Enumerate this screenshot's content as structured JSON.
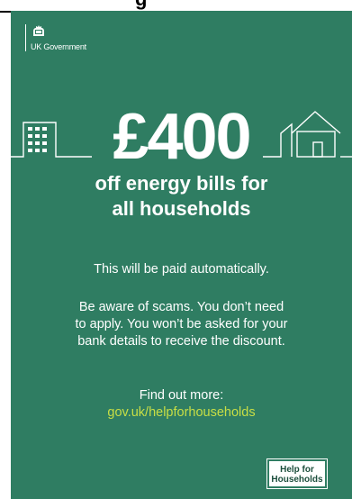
{
  "header": {
    "heading_fragment": "g"
  },
  "poster": {
    "brand": {
      "label": "UK Government",
      "crest_icon": "royal-crest-icon"
    },
    "amount": "£400",
    "headline_line1": "off energy bills for",
    "headline_line2": "all households",
    "paid_note": "This will be paid automatically.",
    "scam_line1": "Be aware of scams. You don’t need",
    "scam_line2": "to apply. You won’t be asked for your",
    "scam_line3": "bank details to receive the discount.",
    "find_out": "Find out more:",
    "url": "gov.uk/helpforhouseholds",
    "badge_line1": "Help for",
    "badge_line2": "Households"
  },
  "colors": {
    "background": "#2f7d62",
    "text": "#ffffff",
    "link": "#c8de45"
  }
}
